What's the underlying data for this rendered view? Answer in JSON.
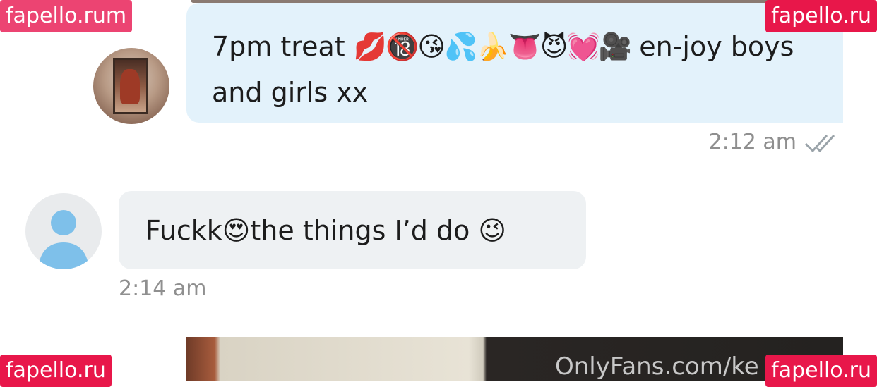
{
  "messages": {
    "outgoing": {
      "text_before": "7pm treat ",
      "emojis": "💋🔞😘💦🍌👅😈💓🎥",
      "text_after": " en-joy boys and girls xx",
      "time": "2:12 am",
      "read_status_icon": "double-check-icon"
    },
    "incoming": {
      "text_part1": "Fuckk",
      "emoji1": "😍",
      "text_part2": "the things I’d do ",
      "emoji2": "😉",
      "time": "2:14 am"
    }
  },
  "media": {
    "watermark_text": "OnlyFans.com/ke"
  },
  "watermarks": {
    "top_left": "fapello.ru",
    "top_left_suffix": "m",
    "top_right": "fapello.ru",
    "bottom_left": "fapello.ru",
    "bottom_right": "fapello.ru"
  },
  "colors": {
    "outgoing_bubble": "#e3f2fb",
    "incoming_bubble": "#eef1f3",
    "watermark_bg": "#e8174a",
    "timestamp": "#8f8f8f"
  }
}
